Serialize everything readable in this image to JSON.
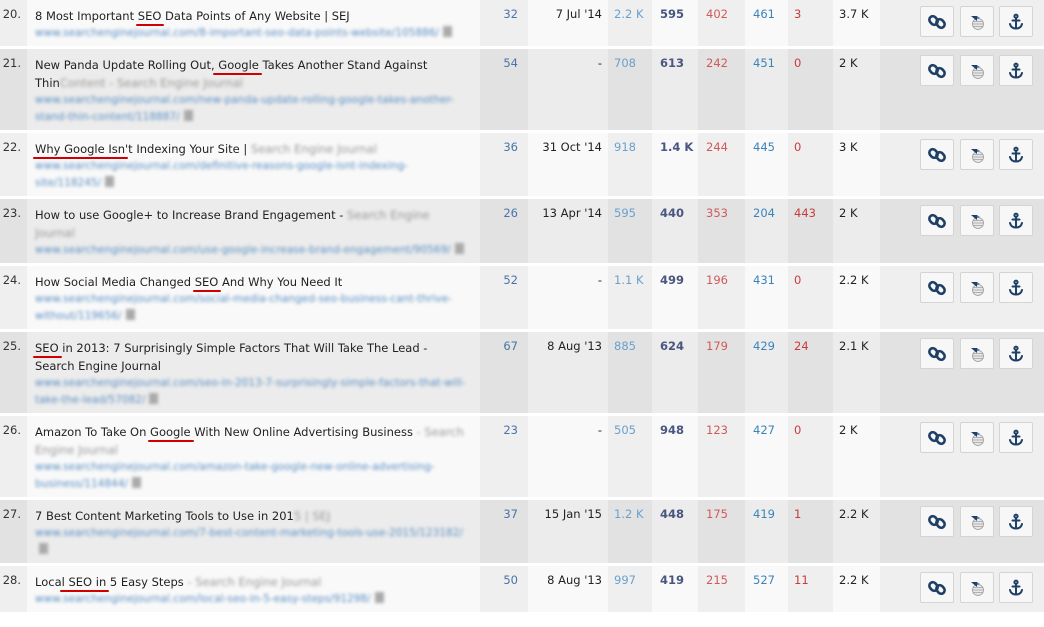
{
  "colors": {
    "highlight_underline": "#d00000",
    "rank": "#4a74a8",
    "col3": "#6aa0cc",
    "col4": "#4a5680",
    "col5": "#d05a5a",
    "col6": "#3a84b8",
    "col7": "#c83c3c",
    "icon": "#1e3f66"
  },
  "actions": {
    "icons": [
      "link-icon",
      "wayback-globe-icon",
      "anchor-icon"
    ]
  },
  "rows": [
    {
      "index": "20.",
      "title_parts": [
        {
          "text": "8 Most Important ",
          "hl": false
        },
        {
          "text": "SEO",
          "hl": true
        },
        {
          "text": " Data Points of Any Website | SEJ",
          "hl": false
        }
      ],
      "title_blurred_suffix": "",
      "url": "www.searchenginejournal.com/8-important-seo-data-points-website/105886/",
      "rank": "32",
      "date": "7 Jul '14",
      "c3": "2.2 K",
      "c4": "595",
      "c5": "402",
      "c6": "461",
      "c7": "3",
      "c8": "3.7 K"
    },
    {
      "index": "21.",
      "title_parts": [
        {
          "text": "New Panda Update Rolling Out,",
          "hl": false
        },
        {
          "text": " Google",
          "hl": true
        },
        {
          "text": " Takes Another Stand Against Thin",
          "hl": false
        }
      ],
      "title_blurred_suffix": "Content - Search Engine Journal",
      "url": "www.searchenginejournal.com/new-panda-update-rolling-google-takes-another-stand-thin-content/118887/",
      "rank": "54",
      "date": "-",
      "c3": "708",
      "c4": "613",
      "c5": "242",
      "c6": "451",
      "c7": "0",
      "c8": "2 K"
    },
    {
      "index": "22.",
      "title_parts": [
        {
          "text": "Why Google Isn",
          "hl": true
        },
        {
          "text": "'t Indexing Your Site |",
          "hl": false
        }
      ],
      "title_blurred_suffix": " Search Engine Journal",
      "url": "www.searchenginejournal.com/definitive-reasons-google-isnt-indexing-site/118245/",
      "rank": "36",
      "date": "31 Oct '14",
      "c3": "918",
      "c4": "1.4 K",
      "c5": "244",
      "c6": "445",
      "c7": "0",
      "c8": "3 K"
    },
    {
      "index": "23.",
      "title_parts": [
        {
          "text": "How to use Google+ to Increase Brand Engagement -",
          "hl": false
        }
      ],
      "title_blurred_suffix": " Search Engine Journal",
      "url": "www.searchenginejournal.com/use-google-increase-brand-engagement/90569/",
      "rank": "26",
      "date": "13 Apr '14",
      "c3": "595",
      "c4": "440",
      "c5": "353",
      "c6": "204",
      "c7": "443",
      "c8": "2 K"
    },
    {
      "index": "24.",
      "title_parts": [
        {
          "text": "How Social Media Changed ",
          "hl": false
        },
        {
          "text": "SEO",
          "hl": true
        },
        {
          "text": " And Why You Need It",
          "hl": false
        }
      ],
      "title_blurred_suffix": "",
      "url": "www.searchenginejournal.com/social-media-changed-seo-business-cant-thrive-without/119656/",
      "rank": "52",
      "date": "-",
      "c3": "1.1 K",
      "c4": "499",
      "c5": "196",
      "c6": "431",
      "c7": "0",
      "c8": "2.2 K"
    },
    {
      "index": "25.",
      "title_parts": [
        {
          "text": "SEO",
          "hl": true
        },
        {
          "text": " in 2013: 7 Surprisingly Simple Factors That Will Take The Lead - Search Engine Journal",
          "hl": false
        }
      ],
      "title_blurred_suffix": "",
      "url": "www.searchenginejournal.com/seo-in-2013-7-surprisingly-simple-factors-that-will-take-the-lead/57082/",
      "rank": "67",
      "date": "8 Aug '13",
      "c3": "885",
      "c4": "624",
      "c5": "179",
      "c6": "429",
      "c7": "24",
      "c8": "2.1 K"
    },
    {
      "index": "26.",
      "title_parts": [
        {
          "text": "Amazon To Take On ",
          "hl": false
        },
        {
          "text": "Google",
          "hl": true
        },
        {
          "text": " With New Online Advertising Business",
          "hl": false
        }
      ],
      "title_blurred_suffix": " - Search Engine Journal",
      "url": "www.searchenginejournal.com/amazon-take-google-new-online-advertising-business/114844/",
      "rank": "23",
      "date": "-",
      "c3": "505",
      "c4": "948",
      "c5": "123",
      "c6": "427",
      "c7": "0",
      "c8": "2 K"
    },
    {
      "index": "27.",
      "title_parts": [
        {
          "text": "7 Best Content Marketing Tools to Use in 201",
          "hl": false
        }
      ],
      "title_blurred_suffix": "5 | SEJ",
      "url": "www.searchenginejournal.com/7-best-content-marketing-tools-use-2015/123182/",
      "rank": "37",
      "date": "15 Jan '15",
      "c3": "1.2 K",
      "c4": "448",
      "c5": "175",
      "c6": "419",
      "c7": "1",
      "c8": "2.2 K"
    },
    {
      "index": "28.",
      "title_parts": [
        {
          "text": "Loca",
          "hl": false
        },
        {
          "text": "l SEO in",
          "hl": true
        },
        {
          "text": " 5 Easy Steps",
          "hl": false
        }
      ],
      "title_blurred_suffix": " - Search Engine Journal",
      "url": "www.searchenginejournal.com/local-seo-in-5-easy-steps/91298/",
      "rank": "50",
      "date": "8 Aug '13",
      "c3": "997",
      "c4": "419",
      "c5": "215",
      "c6": "527",
      "c7": "11",
      "c8": "2.2 K"
    }
  ]
}
